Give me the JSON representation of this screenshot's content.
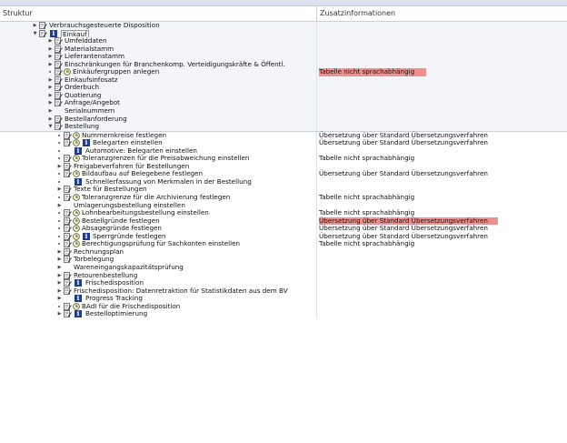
{
  "columns": {
    "structure": "Struktur",
    "additional_info": "Zusatzinformationen"
  },
  "rows": [
    {
      "label": "Verbrauchsgesteuerte Disposition",
      "info": ""
    },
    {
      "label": "Einkauf",
      "info": ""
    },
    {
      "label": "Umfelddaten",
      "info": ""
    },
    {
      "label": "Materialstamm",
      "info": ""
    },
    {
      "label": "Lieferantenstamm",
      "info": ""
    },
    {
      "label": "Einschränkungen für Branchenkomp. Verteidigungskräfte & Öffentl.",
      "info": ""
    },
    {
      "label": "Einkäufergruppen anlegen",
      "info": "Tabelle nicht sprachabhängig"
    },
    {
      "label": "Einkaufsinfosatz",
      "info": ""
    },
    {
      "label": "Orderbuch",
      "info": ""
    },
    {
      "label": "Quotierung",
      "info": ""
    },
    {
      "label": "Anfrage/Angebot",
      "info": ""
    },
    {
      "label": "Serialnummern",
      "info": ""
    },
    {
      "label": "Bestellanforderung",
      "info": ""
    },
    {
      "label": "Bestellung",
      "info": ""
    },
    {
      "label": "Nummernkreise festlegen",
      "info": "Übersetzung über Standard Übersetzungsverfahren"
    },
    {
      "label": "Belegarten einstellen",
      "info": "Übersetzung über Standard Übersetzungsverfahren"
    },
    {
      "label": "Automotive: Belegarten einstellen",
      "info": ""
    },
    {
      "label": "Toleranzgrenzen für die Preisabweichung einstellen",
      "info": "Tabelle nicht sprachabhängig"
    },
    {
      "label": "Freigabeverfahren für Bestellungen",
      "info": ""
    },
    {
      "label": "Bildaufbau auf Belegebene festlegen",
      "info": "Übersetzung über Standard Übersetzungsverfahren"
    },
    {
      "label": "Schnellerfassung von Merkmalen in der Bestellung",
      "info": ""
    },
    {
      "label": "Texte für Bestellungen",
      "info": ""
    },
    {
      "label": "Toleranzgrenze für die Archivierung festlegen",
      "info": "Tabelle nicht sprachabhängig"
    },
    {
      "label": "Umlagerungsbestellung einstellen",
      "info": ""
    },
    {
      "label": "Lohnbearbeitungsbestellung einstellen",
      "info": "Tabelle nicht sprachabhängig"
    },
    {
      "label": "Bestellgründe festlegen",
      "info": "Übersetzung über Standard Übersetzungsverfahren"
    },
    {
      "label": "Absagegründe festlegen",
      "info": "Übersetzung über Standard Übersetzungsverfahren"
    },
    {
      "label": "Sperrgründe festlegen",
      "info": "Übersetzung über Standard Übersetzungsverfahren"
    },
    {
      "label": "Berechtigungsprüfung für Sachkonten einstellen",
      "info": "Tabelle nicht sprachabhängig"
    },
    {
      "label": "Rechnungsplan",
      "info": ""
    },
    {
      "label": "Torbelegung",
      "info": ""
    },
    {
      "label": "Wareneingangskapazitätsprüfung",
      "info": ""
    },
    {
      "label": "Retourenbestellung",
      "info": ""
    },
    {
      "label": "Frischedisposition",
      "info": ""
    },
    {
      "label": "Frischedisposition: Datenretraktion für Statistikdaten aus dem BV",
      "info": ""
    },
    {
      "label": "Progress Tracking",
      "info": ""
    },
    {
      "label": "BAdI für die Frischedisposition",
      "info": ""
    },
    {
      "label": "Bestelloptimierung",
      "info": ""
    }
  ],
  "colors": {
    "highlight": "#f08f8f",
    "info_icon": "#1f3d8c",
    "header_line": "#c8d0d8"
  }
}
